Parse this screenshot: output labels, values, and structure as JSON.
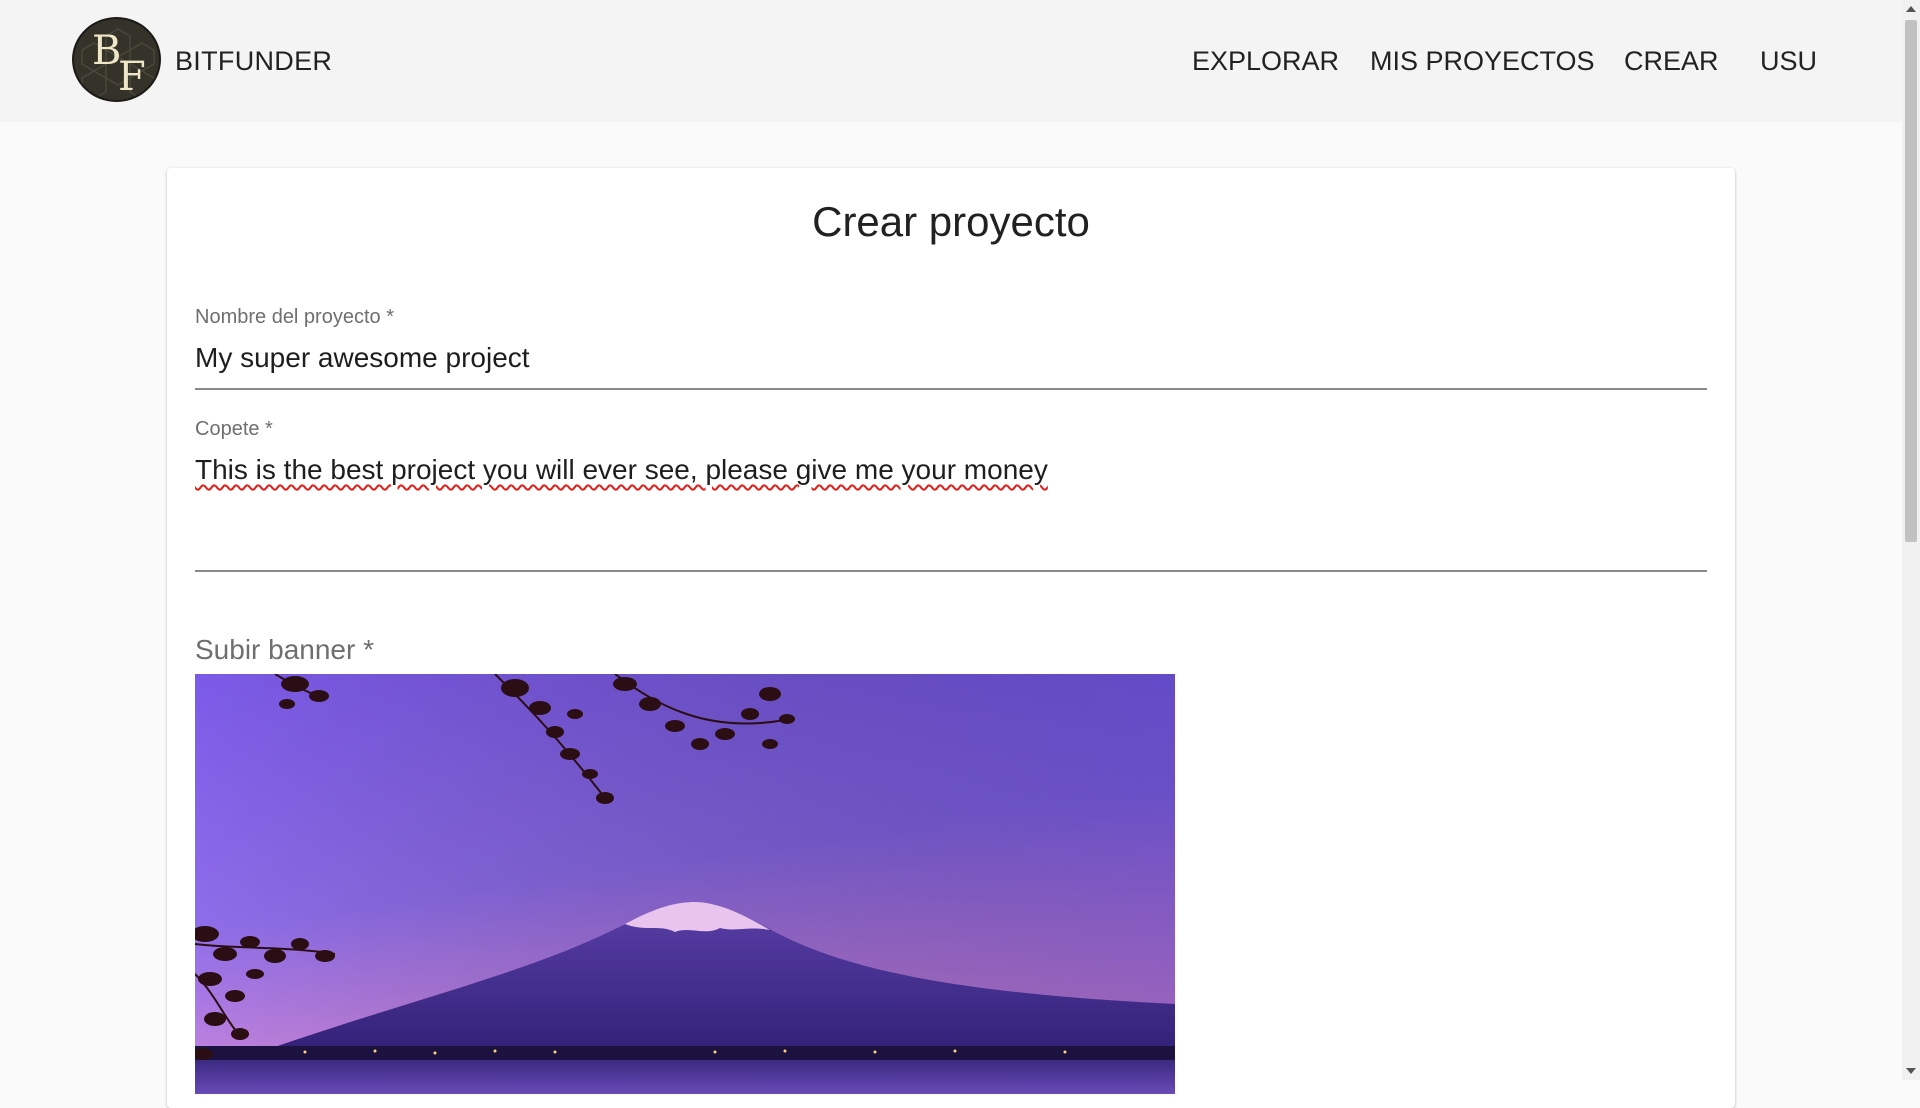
{
  "header": {
    "logo_letters": {
      "first": "B",
      "second": "F"
    },
    "brand": "BITFUNDER",
    "nav": {
      "explore": "EXPLORAR",
      "my_projects": "MIS PROYECTOS",
      "create": "CREAR",
      "user": "USU"
    }
  },
  "form": {
    "title": "Crear proyecto",
    "name_field": {
      "label": "Nombre del proyecto *",
      "value": "My super awesome project"
    },
    "copete_field": {
      "label": "Copete *",
      "value": "This is the best project you will ever see, please give me your money"
    },
    "banner": {
      "label": "Subir banner *"
    }
  },
  "colors": {
    "header_bg": "#f4f4f4",
    "page_bg": "#fafafa",
    "card_bg": "#ffffff",
    "logo_bg": "#343229",
    "spellcheck": "#e0201a"
  }
}
